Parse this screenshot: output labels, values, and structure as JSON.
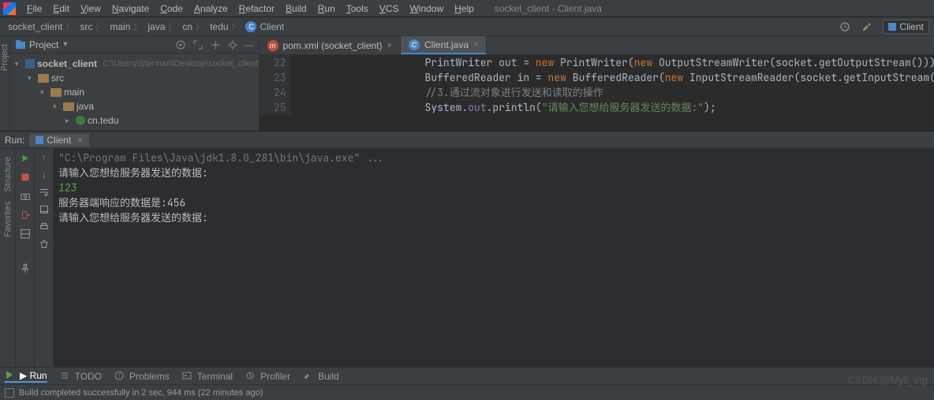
{
  "window_title": "socket_client - Client.java",
  "menu": [
    "File",
    "Edit",
    "View",
    "Navigate",
    "Code",
    "Analyze",
    "Refactor",
    "Build",
    "Run",
    "Tools",
    "VCS",
    "Window",
    "Help"
  ],
  "breadcrumb": [
    "socket_client",
    "src",
    "main",
    "java",
    "cn",
    "tedu",
    "Client"
  ],
  "run_config_chip": "Client",
  "project": {
    "title": "Project",
    "root": {
      "name": "socket_client",
      "path": "C:\\Users\\Sterman\\Desktop\\socket_client"
    },
    "nodes": [
      {
        "indent": 1,
        "name": "src"
      },
      {
        "indent": 2,
        "name": "main"
      },
      {
        "indent": 3,
        "name": "java"
      },
      {
        "indent": 4,
        "name": "cn.tedu"
      }
    ]
  },
  "editor": {
    "tabs": [
      {
        "label": "pom.xml (socket_client)",
        "active": false,
        "icon": "m"
      },
      {
        "label": "Client.java",
        "active": true,
        "icon": "c"
      }
    ],
    "lines": [
      {
        "n": 22,
        "html": "PrintWriter out = <span class='kw'>new</span> PrintWriter(<span class='kw'>new</span> OutputStreamWriter(socket.getOutputStream()));"
      },
      {
        "n": 23,
        "html": "BufferedReader in = <span class='kw'>new</span> BufferedReader(<span class='kw'>new</span> InputStreamReader(socket.getInputStream())"
      },
      {
        "n": 24,
        "html": "<span class='cmt'>//3.通过流对象进行发送和读取的操作</span>"
      },
      {
        "n": 25,
        "html": "System.<span class='fld'>out</span>.println(<span class='str'>\"请输入您想给服务器发送的数据:\"</span>);"
      }
    ]
  },
  "run": {
    "label": "Run:",
    "tab": "Client",
    "console": [
      {
        "cls": "cmd",
        "text": "\"C:\\Program Files\\Java\\jdk1.8.0_281\\bin\\java.exe\" ..."
      },
      {
        "cls": "",
        "text": "请输入您想给服务器发送的数据:"
      },
      {
        "cls": "input",
        "text": "123"
      },
      {
        "cls": "",
        "text": "服务器端响应的数据是:456"
      },
      {
        "cls": "",
        "text": "请输入您想给服务器发送的数据:"
      }
    ]
  },
  "left_rail": [
    "Project",
    "Structure",
    "Favorites"
  ],
  "tool_tabs": [
    {
      "label": "Run",
      "icon": "run",
      "active": true
    },
    {
      "label": "TODO",
      "icon": "todo",
      "active": false
    },
    {
      "label": "Problems",
      "icon": "problems",
      "active": false
    },
    {
      "label": "Terminal",
      "icon": "terminal",
      "active": false
    },
    {
      "label": "Profiler",
      "icon": "profiler",
      "active": false
    },
    {
      "label": "Build",
      "icon": "build",
      "active": false
    }
  ],
  "statusbar": "Build completed successfully in 2 sec, 944 ms (22 minutes ago)",
  "watermark": "CSDN @Myli_ing"
}
